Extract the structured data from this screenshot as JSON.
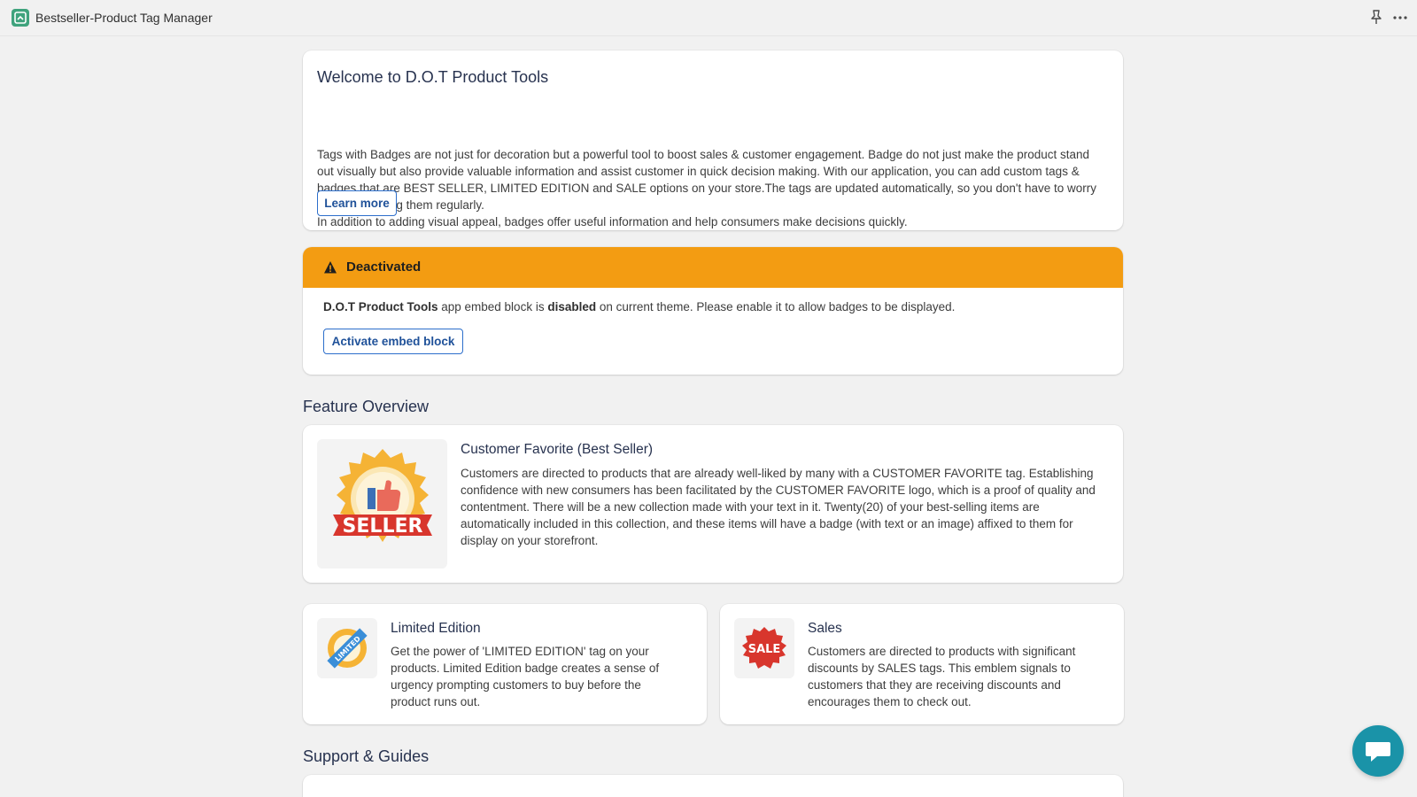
{
  "app": {
    "title": "Bestseller-Product Tag Manager",
    "icon": "app-tag-icon",
    "actions": [
      "pin-icon",
      "more-icon"
    ]
  },
  "welcome": {
    "title": "Welcome to D.O.T Product Tools",
    "description": "Tags with Badges are not just for decoration but a powerful tool to boost sales & customer engagement. Badge do not just make the product stand out visually but also provide valuable information and assist customer in quick decision making. With our application, you can add custom tags & badges that are BEST SELLER, LIMITED EDITION and SALE options on your store.The tags are updated automatically, so you don't have to worry about managing them regularly.",
    "description2": "In addition to adding visual appeal, badges offer useful information and help consumers make decisions quickly.",
    "learn_more": "Learn more"
  },
  "status": {
    "title": "Deactivated",
    "app_name": "D.O.T Product Tools",
    "text_mid": " app embed block is ",
    "state": "disabled",
    "text_end": " on current theme. Please enable it to allow badges to be displayed.",
    "button": "Activate embed block",
    "color": "#f39c12"
  },
  "features": {
    "section_title": "Feature Overview",
    "items": [
      {
        "title": "Customer Favorite (Best Seller)",
        "description": "Customers are directed to products that are already well-liked by many with a CUSTOMER FAVORITE tag. Establishing confidence with new consumers has been facilitated by the CUSTOMER FAVORITE logo, which is a proof of quality and contentment. There will be a new collection made with your text in it. Twenty(20) of your best-selling items are automatically included in this collection, and these items will have a badge (with text or an image) affixed to them for display on your storefront.",
        "badge_text": "SELLER",
        "icon": "best-seller-badge-icon"
      },
      {
        "title": "Limited Edition",
        "description": "Get the power of 'LIMITED EDITION' tag on your products. Limited Edition badge creates a sense of urgency prompting customers to buy before the product runs out.",
        "badge_text": "LIMITED",
        "icon": "limited-edition-badge-icon"
      },
      {
        "title": "Sales",
        "description": "Customers are directed to products with significant discounts by SALES tags. This emblem signals to customers that they are receiving discounts and encourages them to check out.",
        "badge_text": "SALE",
        "icon": "sale-badge-icon"
      }
    ]
  },
  "support": {
    "section_title": "Support & Guides"
  },
  "chat": {
    "icon": "chat-icon",
    "color": "#1a93a8"
  }
}
